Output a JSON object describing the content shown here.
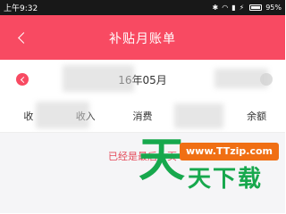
{
  "status_bar": {
    "time": "上午9:32",
    "battery": "95%"
  },
  "navbar": {
    "title": "补贴月账单"
  },
  "month": {
    "label": "16年05月"
  },
  "summary": {
    "columns": [
      "收",
      "收入",
      "消费",
      "",
      "余额"
    ]
  },
  "content": {
    "status_message": "已经是最后一页"
  },
  "watermark": {
    "url": "www.TTzip.com",
    "big_char": "天",
    "text": "天下载"
  },
  "colors": {
    "accent": "#f84a62",
    "watermark_green": "#17a84d",
    "watermark_orange": "#f06f14"
  }
}
